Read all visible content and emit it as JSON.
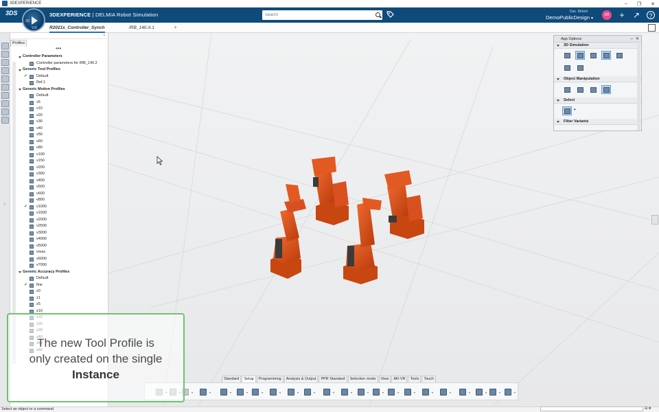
{
  "os": {
    "title": "3DEXPERIENCE",
    "ctrl_min": "–",
    "ctrl_max": "❐",
    "ctrl_close": "✕"
  },
  "header": {
    "logo": "3DS",
    "compass_left": "3D",
    "compass_right": "V,R",
    "brand_bold": "3DEXPERIENCE",
    "brand_rest": " | DELMIA Robot Simulation",
    "search_placeholder": "Search",
    "user": "Dan. Birkett",
    "tenant": "DemoPublicDesign",
    "tenant_chevron": "▾",
    "avatar": "DB",
    "add_icon": "+",
    "share_icon": "↗",
    "help_icon": "?"
  },
  "tabs": [
    {
      "label": "R2021x_Controller_Synch",
      "active": true
    },
    {
      "label": "IRB_140.A.1",
      "active": false
    }
  ],
  "tab_add": "+",
  "panel": {
    "tab": "Profiles",
    "collapse": "‹",
    "dots": "•••"
  },
  "tree": [
    {
      "type": "cat",
      "label": "Controller Parameters",
      "indent": 0
    },
    {
      "type": "item",
      "label": "Controller parameters for IRB_140.2",
      "indent": 1
    },
    {
      "type": "cat",
      "label": "Generic Tool Profiles",
      "indent": 0
    },
    {
      "type": "item",
      "label": "Default",
      "indent": 1,
      "check": true
    },
    {
      "type": "item",
      "label": "Ref.1",
      "indent": 1
    },
    {
      "type": "cat",
      "label": "Generic Motion Profiles",
      "indent": 0
    },
    {
      "type": "item",
      "label": "Default",
      "indent": 1
    },
    {
      "type": "item",
      "label": "v5",
      "indent": 1
    },
    {
      "type": "item",
      "label": "v10",
      "indent": 1
    },
    {
      "type": "item",
      "label": "v20",
      "indent": 1
    },
    {
      "type": "item",
      "label": "v30",
      "indent": 1
    },
    {
      "type": "item",
      "label": "v40",
      "indent": 1
    },
    {
      "type": "item",
      "label": "v50",
      "indent": 1
    },
    {
      "type": "item",
      "label": "v60",
      "indent": 1
    },
    {
      "type": "item",
      "label": "v80",
      "indent": 1
    },
    {
      "type": "item",
      "label": "v100",
      "indent": 1
    },
    {
      "type": "item",
      "label": "v150",
      "indent": 1
    },
    {
      "type": "item",
      "label": "v200",
      "indent": 1
    },
    {
      "type": "item",
      "label": "v300",
      "indent": 1
    },
    {
      "type": "item",
      "label": "v400",
      "indent": 1
    },
    {
      "type": "item",
      "label": "v500",
      "indent": 1
    },
    {
      "type": "item",
      "label": "v600",
      "indent": 1
    },
    {
      "type": "item",
      "label": "v800",
      "indent": 1
    },
    {
      "type": "item",
      "label": "v1000",
      "indent": 1,
      "check": true
    },
    {
      "type": "item",
      "label": "v1500",
      "indent": 1
    },
    {
      "type": "item",
      "label": "v2000",
      "indent": 1
    },
    {
      "type": "item",
      "label": "v2500",
      "indent": 1
    },
    {
      "type": "item",
      "label": "v3000",
      "indent": 1
    },
    {
      "type": "item",
      "label": "v4000",
      "indent": 1
    },
    {
      "type": "item",
      "label": "v5000",
      "indent": 1
    },
    {
      "type": "item",
      "label": "vmax",
      "indent": 1
    },
    {
      "type": "item",
      "label": "v6000",
      "indent": 1
    },
    {
      "type": "item",
      "label": "v7000",
      "indent": 1
    },
    {
      "type": "cat",
      "label": "Generic Accuracy Profiles",
      "indent": 0
    },
    {
      "type": "item",
      "label": "Default",
      "indent": 1
    },
    {
      "type": "item",
      "label": "fine",
      "indent": 1,
      "check": true
    },
    {
      "type": "item",
      "label": "z0",
      "indent": 1
    },
    {
      "type": "item",
      "label": "z1",
      "indent": 1
    },
    {
      "type": "item",
      "label": "z5",
      "indent": 1
    },
    {
      "type": "item",
      "label": "z10",
      "indent": 1
    },
    {
      "type": "item",
      "label": "z15",
      "indent": 1
    },
    {
      "type": "item",
      "label": "z20",
      "indent": 1
    },
    {
      "type": "item",
      "label": "z30",
      "indent": 1
    },
    {
      "type": "item",
      "label": "z40",
      "indent": 1
    },
    {
      "type": "item",
      "label": "z50",
      "indent": 1
    },
    {
      "type": "item",
      "label": "z60",
      "indent": 1
    }
  ],
  "app_options": {
    "title": "App Options",
    "min": "–",
    "close": "✕",
    "sections": [
      {
        "label": "3D Simulation"
      },
      {
        "label": "Object Manipulation"
      },
      {
        "label": "Select"
      },
      {
        "label": "Filter Variants"
      }
    ]
  },
  "section_tabs": [
    {
      "label": "Standard"
    },
    {
      "label": "Setup",
      "active": true
    },
    {
      "label": "Programming"
    },
    {
      "label": "Analysis & Output"
    },
    {
      "label": "PPR Standard"
    },
    {
      "label": "Selection mode"
    },
    {
      "label": "View"
    },
    {
      "label": "AR-VR"
    },
    {
      "label": "Tools"
    },
    {
      "label": "Touch"
    }
  ],
  "actions": [
    {
      "name": "cut-icon",
      "dim": true
    },
    {
      "name": "copy-icon",
      "dim": true
    },
    {
      "name": "paste-icon",
      "dim": true
    },
    {
      "name": "undo-icon"
    },
    {
      "name": "robot-cell-icon"
    },
    {
      "name": "robot-add-icon"
    },
    {
      "name": "robot-program-icon"
    },
    {
      "name": "robot-teach-icon"
    },
    {
      "name": "robot-setup-icon"
    },
    {
      "name": "robot-mount-icon"
    },
    {
      "name": "robot-tool-icon"
    },
    {
      "name": "robot-reach-icon"
    },
    {
      "name": "robot-path-icon"
    },
    {
      "name": "robot-frames-icon"
    },
    {
      "name": "robot-sequence-icon"
    },
    {
      "name": "robot-points-icon"
    },
    {
      "name": "robot-connect-icon"
    },
    {
      "name": "robot-move-icon"
    },
    {
      "name": "robot-simulate-icon"
    },
    {
      "name": "robot-ik-icon"
    },
    {
      "name": "robot-mech-icon"
    },
    {
      "name": "robot-table-icon"
    }
  ],
  "status": {
    "prompt": "Select an object or a command"
  },
  "caption": {
    "line1": "The new Tool Profile is",
    "line2": "only created on the single",
    "line3": "Instance"
  },
  "colors": {
    "header": "#0e4a7a",
    "robot": "#e0541c",
    "caption_border": "#6ec26e"
  }
}
